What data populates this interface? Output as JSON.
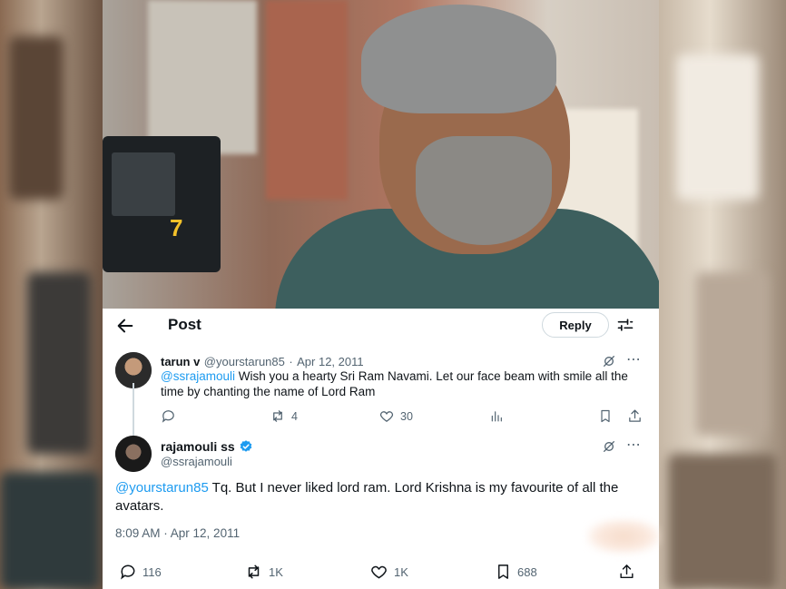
{
  "header": {
    "title": "Post",
    "reply_label": "Reply"
  },
  "reply_tweet": {
    "display_name": "tarun v",
    "handle": "@yourstarun85",
    "date": "Apr 12, 2011",
    "mention": "@ssrajamouli",
    "text": " Wish you a hearty Sri Ram Navami. Let our face beam with smile all the time by chanting the name of Lord Ram",
    "retweets": "4",
    "likes": "30"
  },
  "main_tweet": {
    "display_name": "rajamouli ss",
    "handle": "@ssrajamouli",
    "verified": true,
    "mention": "@yourstarun85",
    "text": " Tq. But I never liked lord ram. Lord Krishna is my favourite of all the avatars.",
    "timestamp": "8:09 AM · Apr 12, 2011",
    "replies": "116",
    "retweets": "1K",
    "likes": "1K",
    "bookmarks": "688"
  },
  "colors": {
    "link": "#1d9bf0",
    "verified": "#1d9bf0",
    "muted": "#536471"
  }
}
